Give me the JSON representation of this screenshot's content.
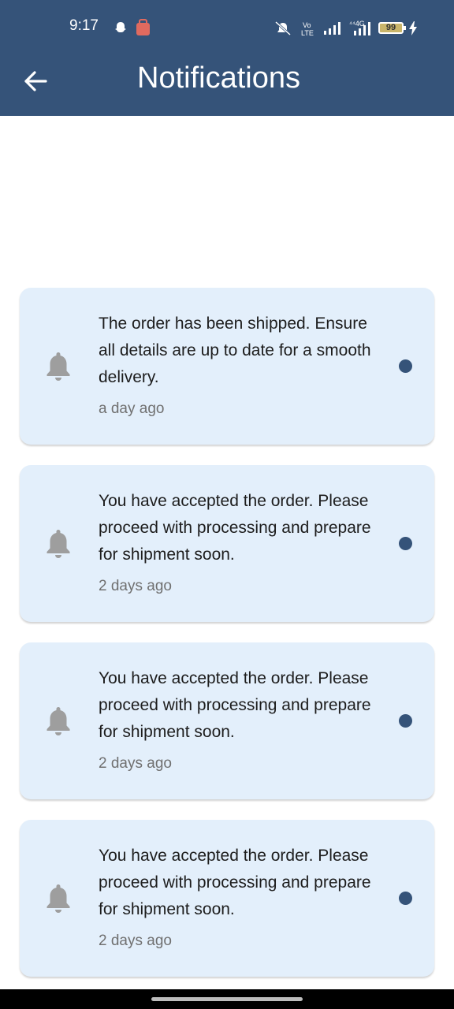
{
  "status_bar": {
    "time": "9:17",
    "battery": "99",
    "icons": [
      "snapchat-icon",
      "app-notification-icon",
      "mute-icon",
      "volte-icon",
      "signal-icon",
      "4g-signal-icon",
      "battery-icon",
      "charging-icon"
    ]
  },
  "header": {
    "title": "Notifications",
    "back_icon": "arrow-left-icon",
    "background": "#355379"
  },
  "notifications": [
    {
      "message": "The order has been shipped. Ensure all details are up to date for a smooth delivery.",
      "time": "a day ago",
      "unread": true
    },
    {
      "message": "You have accepted the order. Please proceed with processing and prepare for shipment soon.",
      "time": "2 days ago",
      "unread": true
    },
    {
      "message": "You have accepted the order. Please proceed with processing and prepare for shipment soon.",
      "time": "2 days ago",
      "unread": true
    },
    {
      "message": "You have accepted the order. Please proceed with processing and prepare for shipment soon.",
      "time": "2 days ago",
      "unread": true
    }
  ],
  "colors": {
    "card_background": "#e3effb",
    "unread_dot": "#355379",
    "bell": "#9e9e9e"
  }
}
